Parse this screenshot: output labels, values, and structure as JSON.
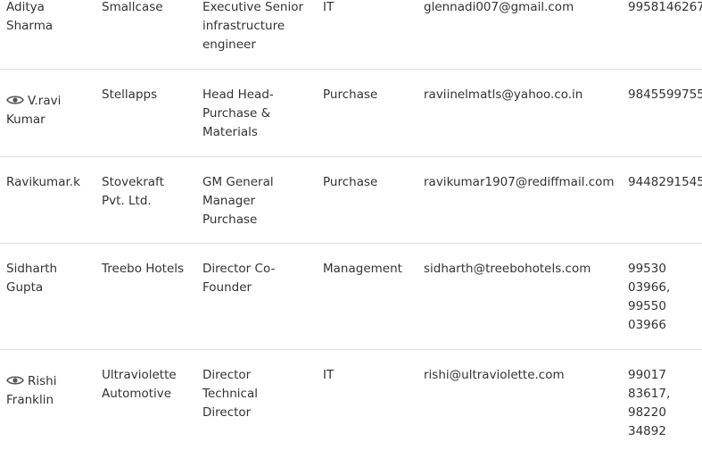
{
  "contacts": [
    {
      "name_lines": [
        "Aditya",
        "Sharma"
      ],
      "has_view_icon": false,
      "company_lines": [
        "Smallcase"
      ],
      "designation_lines": [
        "Executive Senior",
        "infrastructure",
        "engineer"
      ],
      "department": "IT",
      "email": "glennadi007@gmail.com",
      "phone_lines": [
        "9958146267"
      ]
    },
    {
      "name_lines": [
        "V.ravi",
        "Kumar"
      ],
      "has_view_icon": true,
      "company_lines": [
        "Stellapps"
      ],
      "designation_lines": [
        "Head Head-",
        "Purchase &",
        "Materials"
      ],
      "department": "Purchase",
      "email": "raviinelmatls@yahoo.co.in",
      "phone_lines": [
        "9845599755"
      ]
    },
    {
      "name_lines": [
        "Ravikumar.k"
      ],
      "has_view_icon": false,
      "company_lines": [
        "Stovekraft",
        "Pvt. Ltd."
      ],
      "designation_lines": [
        "GM General",
        "Manager",
        "Purchase"
      ],
      "department": "Purchase",
      "email": "ravikumar1907@rediffmail.com",
      "phone_lines": [
        "9448291545"
      ]
    },
    {
      "name_lines": [
        "Sidharth",
        "Gupta"
      ],
      "has_view_icon": false,
      "company_lines": [
        "Treebo Hotels"
      ],
      "designation_lines": [
        "Director Co-",
        "Founder"
      ],
      "department": "Management",
      "email": "sidharth@treebohotels.com",
      "phone_lines": [
        "99530",
        "03966,",
        "99550",
        "03966"
      ]
    },
    {
      "name_lines": [
        "Rishi",
        "Franklin"
      ],
      "has_view_icon": true,
      "company_lines": [
        "Ultraviolette",
        "Automotive"
      ],
      "designation_lines": [
        "Director",
        "Technical",
        "Director"
      ],
      "department": "IT",
      "email": "rishi@ultraviolette.com",
      "phone_lines": [
        "99017",
        "83617,",
        "98220",
        "34892"
      ]
    }
  ],
  "icons": {
    "view": "eye-icon"
  },
  "colors": {
    "text": "#333333",
    "divider": "#dddddd",
    "icon": "#555555"
  }
}
